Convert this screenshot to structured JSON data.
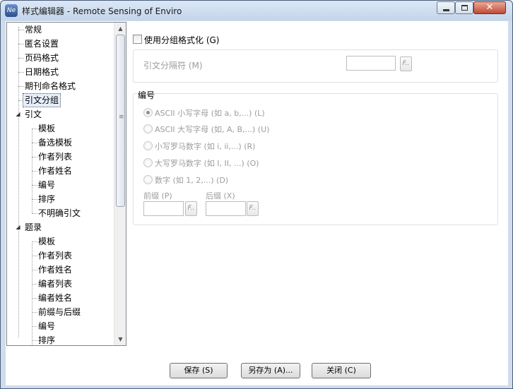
{
  "window": {
    "title": "样式编辑器 - Remote Sensing of Enviro",
    "app_icon": "Ne"
  },
  "tree": {
    "items": [
      {
        "label": "常规"
      },
      {
        "label": "匿名设置"
      },
      {
        "label": "页码格式"
      },
      {
        "label": "日期格式"
      },
      {
        "label": "期刊命名格式"
      },
      {
        "label": "引文分组",
        "selected": true
      },
      {
        "label": "引文",
        "expanded": true
      },
      {
        "label": "模板"
      },
      {
        "label": "备选模板"
      },
      {
        "label": "作者列表"
      },
      {
        "label": "作者姓名"
      },
      {
        "label": "编号"
      },
      {
        "label": "排序"
      },
      {
        "label": "不明确引文"
      },
      {
        "label": "题录",
        "expanded": true
      },
      {
        "label": "模板"
      },
      {
        "label": "作者列表"
      },
      {
        "label": "作者姓名"
      },
      {
        "label": "编者列表"
      },
      {
        "label": "编者姓名"
      },
      {
        "label": "前缀与后缀"
      },
      {
        "label": "编号"
      },
      {
        "label": "排序"
      }
    ]
  },
  "options": {
    "use_grouping": {
      "label": "使用分组格式化 (G)",
      "checked": false
    },
    "separator": {
      "label": "引文分隔符 (M)",
      "value": "",
      "button": "F.."
    },
    "numbering": {
      "title": "编号",
      "radios": [
        {
          "label": "ASCII 小写字母 (如 a, b,...) (L)",
          "selected": true
        },
        {
          "label": "ASCII 大写字母 (如, A, B,...) (U)",
          "selected": false
        },
        {
          "label": "小写罗马数字 (如 i, ii,...) (R)",
          "selected": false
        },
        {
          "label": "大写罗马数字 (如 I, II, ...) (O)",
          "selected": false
        },
        {
          "label": "数字 (如 1, 2,...) (D)",
          "selected": false
        }
      ],
      "prefix": {
        "label": "前缀 (P)",
        "value": "",
        "button": "F.."
      },
      "suffix": {
        "label": "后缀 (X)",
        "value": "",
        "button": "F.."
      }
    }
  },
  "buttons": {
    "save": "保存 (S)",
    "save_as": "另存为 (A)...",
    "close": "关闭 (C)"
  },
  "colors": {
    "titlebar": "#c4d5ea",
    "close_button": "#c14a33",
    "disabled_text": "#9c9c9c"
  }
}
